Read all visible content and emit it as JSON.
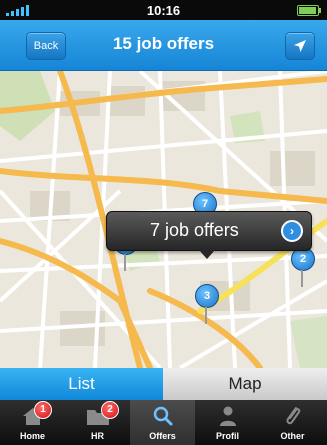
{
  "status_bar": {
    "time": "10:16"
  },
  "nav": {
    "back_label": "Back",
    "title": "15 job offers",
    "locate_icon": "location-arrow-icon"
  },
  "map": {
    "callout": {
      "text": "7 job offers",
      "icon": "chevron-right-icon"
    },
    "pins": [
      {
        "count": "3"
      },
      {
        "count": "7"
      },
      {
        "count": "3"
      },
      {
        "count": "2"
      }
    ]
  },
  "segmented": {
    "list_label": "List",
    "map_label": "Map",
    "selected": "List"
  },
  "tabs": [
    {
      "label": "Home",
      "icon": "home-icon",
      "badge": "1"
    },
    {
      "label": "HR",
      "icon": "folder-icon",
      "badge": "2"
    },
    {
      "label": "Offers",
      "icon": "search-icon",
      "badge": ""
    },
    {
      "label": "Profil",
      "icon": "person-icon",
      "badge": ""
    },
    {
      "label": "Other",
      "icon": "paperclip-icon",
      "badge": ""
    }
  ],
  "colors": {
    "nav_blue": "#1f8fdc",
    "badge_red": "#d31212",
    "tab_bar": "#1a1a1a",
    "pin_blue": "#2e8fe0"
  }
}
